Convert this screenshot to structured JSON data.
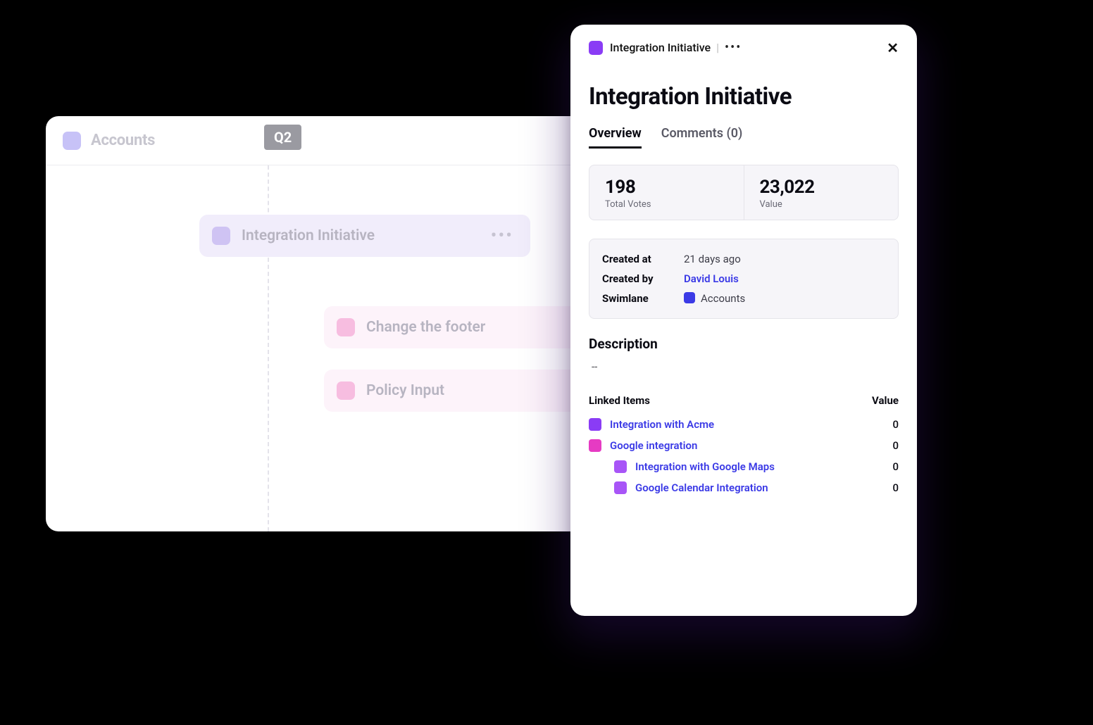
{
  "board": {
    "swimlane_label": "Accounts",
    "quarter_label": "Q2",
    "cards": [
      {
        "label": "Integration Initiative",
        "color": "purple",
        "has_menu": true
      },
      {
        "label": "Change the footer",
        "color": "pink",
        "has_menu": false
      },
      {
        "label": "Policy Input",
        "color": "pink",
        "has_menu": false
      }
    ]
  },
  "panel": {
    "breadcrumb": "Integration Initiative",
    "title": "Integration Initiative",
    "tabs": [
      {
        "label": "Overview",
        "active": true
      },
      {
        "label": "Comments (0)",
        "active": false
      }
    ],
    "stats": {
      "votes_value": "198",
      "votes_label": "Total Votes",
      "value_value": "23,022",
      "value_label": "Value"
    },
    "meta": {
      "created_at_key": "Created at",
      "created_at_value": "21 days ago",
      "created_by_key": "Created by",
      "created_by_value": "David Louis",
      "swimlane_key": "Swimlane",
      "swimlane_value": "Accounts"
    },
    "description_heading": "Description",
    "description_body": "--",
    "linked_heading": "Linked Items",
    "linked_value_heading": "Value",
    "linked_items": [
      {
        "name": "Integration with Acme",
        "value": "0",
        "color": "purple",
        "nested": false
      },
      {
        "name": "Google integration",
        "value": "0",
        "color": "magenta",
        "nested": false
      },
      {
        "name": "Integration with Google Maps",
        "value": "0",
        "color": "purple-lt",
        "nested": true
      },
      {
        "name": "Google Calendar Integration",
        "value": "0",
        "color": "purple-lt",
        "nested": true
      }
    ]
  }
}
